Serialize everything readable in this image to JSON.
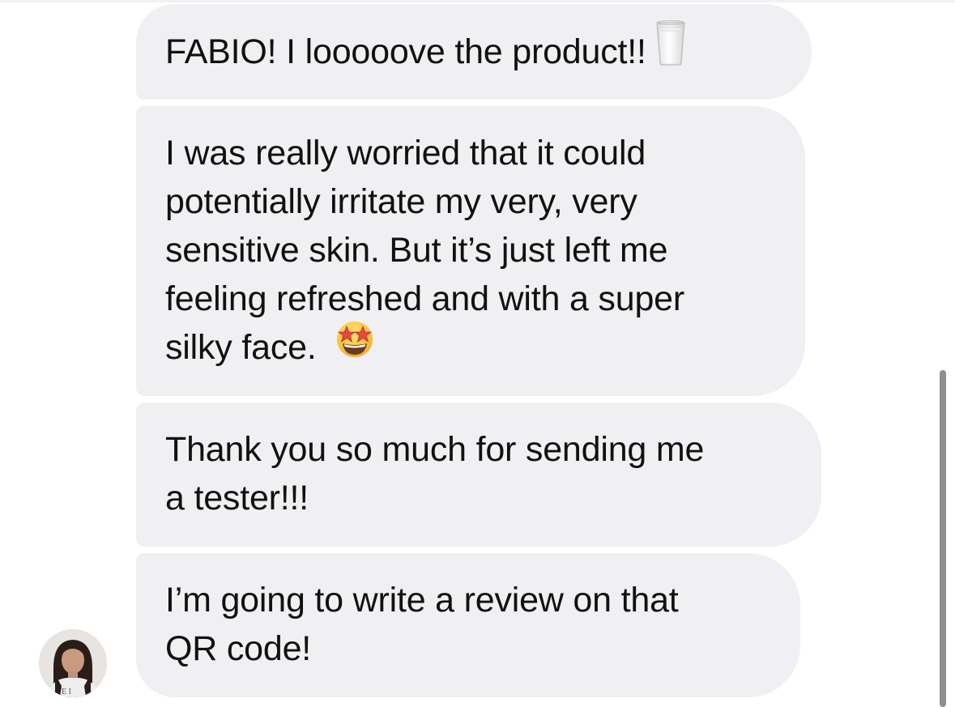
{
  "conversation": {
    "messages": [
      {
        "text": "FABIO! I looooove the product!!",
        "emoji": "glass-of-milk-icon"
      },
      {
        "text": "I was really worried that it could\npotentially irritate my very, very\nsensitive skin. But it’s just left me\nfeeling refreshed and with a super\nsilky face.",
        "emoji": "star-struck-face-icon"
      },
      {
        "text": "Thank you so much for sending me\na tester!!!"
      },
      {
        "text": "I’m going to write a review on that\nQR code!"
      }
    ],
    "sender_avatar": "sender-avatar"
  },
  "colors": {
    "bubble_background": "#f0f0f2",
    "text": "#111111",
    "scrollbar": "#8e8e93",
    "page_background": "#ffffff"
  }
}
